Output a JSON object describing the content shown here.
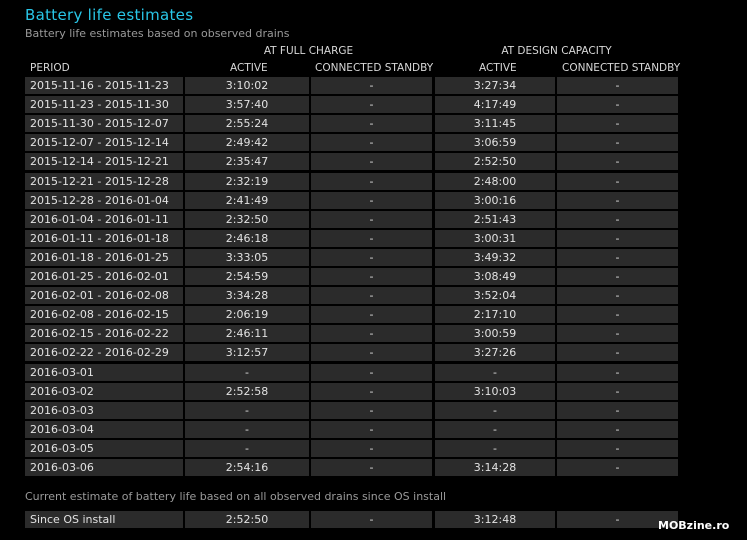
{
  "header": {
    "title": "Battery life estimates",
    "subtitle": "Battery life estimates based on observed drains"
  },
  "table": {
    "group_full": "AT FULL CHARGE",
    "group_design": "AT DESIGN CAPACITY",
    "col_period": "PERIOD",
    "col_full_active": "ACTIVE",
    "col_full_standby": "CONNECTED STANDBY",
    "col_design_active": "ACTIVE",
    "col_design_standby": "CONNECTED STANDBY",
    "rows": [
      {
        "period": "2015-11-16 - 2015-11-23",
        "full_active": "3:10:02",
        "full_standby": "-",
        "design_active": "3:27:34",
        "design_standby": "-"
      },
      {
        "period": "2015-11-23 - 2015-11-30",
        "full_active": "3:57:40",
        "full_standby": "-",
        "design_active": "4:17:49",
        "design_standby": "-"
      },
      {
        "period": "2015-11-30 - 2015-12-07",
        "full_active": "2:55:24",
        "full_standby": "-",
        "design_active": "3:11:45",
        "design_standby": "-"
      },
      {
        "period": "2015-12-07 - 2015-12-14",
        "full_active": "2:49:42",
        "full_standby": "-",
        "design_active": "3:06:59",
        "design_standby": "-"
      },
      {
        "period": "2015-12-14 - 2015-12-21",
        "full_active": "2:35:47",
        "full_standby": "-",
        "design_active": "2:52:50",
        "design_standby": "-"
      },
      {
        "period": "2015-12-21 - 2015-12-28",
        "full_active": "2:32:19",
        "full_standby": "-",
        "design_active": "2:48:00",
        "design_standby": "-"
      },
      {
        "period": "2015-12-28 - 2016-01-04",
        "full_active": "2:41:49",
        "full_standby": "-",
        "design_active": "3:00:16",
        "design_standby": "-"
      },
      {
        "period": "2016-01-04 - 2016-01-11",
        "full_active": "2:32:50",
        "full_standby": "-",
        "design_active": "2:51:43",
        "design_standby": "-"
      },
      {
        "period": "2016-01-11 - 2016-01-18",
        "full_active": "2:46:18",
        "full_standby": "-",
        "design_active": "3:00:31",
        "design_standby": "-"
      },
      {
        "period": "2016-01-18 - 2016-01-25",
        "full_active": "3:33:05",
        "full_standby": "-",
        "design_active": "3:49:32",
        "design_standby": "-"
      },
      {
        "period": "2016-01-25 - 2016-02-01",
        "full_active": "2:54:59",
        "full_standby": "-",
        "design_active": "3:08:49",
        "design_standby": "-"
      },
      {
        "period": "2016-02-01 - 2016-02-08",
        "full_active": "3:34:28",
        "full_standby": "-",
        "design_active": "3:52:04",
        "design_standby": "-"
      },
      {
        "period": "2016-02-08 - 2016-02-15",
        "full_active": "2:06:19",
        "full_standby": "-",
        "design_active": "2:17:10",
        "design_standby": "-"
      },
      {
        "period": "2016-02-15 - 2016-02-22",
        "full_active": "2:46:11",
        "full_standby": "-",
        "design_active": "3:00:59",
        "design_standby": "-"
      },
      {
        "period": "2016-02-22 - 2016-02-29",
        "full_active": "3:12:57",
        "full_standby": "-",
        "design_active": "3:27:26",
        "design_standby": "-"
      },
      {
        "period": "2016-03-01",
        "full_active": "-",
        "full_standby": "-",
        "design_active": "-",
        "design_standby": "-"
      },
      {
        "period": "2016-03-02",
        "full_active": "2:52:58",
        "full_standby": "-",
        "design_active": "3:10:03",
        "design_standby": "-"
      },
      {
        "period": "2016-03-03",
        "full_active": "-",
        "full_standby": "-",
        "design_active": "-",
        "design_standby": "-"
      },
      {
        "period": "2016-03-04",
        "full_active": "-",
        "full_standby": "-",
        "design_active": "-",
        "design_standby": "-"
      },
      {
        "period": "2016-03-05",
        "full_active": "-",
        "full_standby": "-",
        "design_active": "-",
        "design_standby": "-"
      },
      {
        "period": "2016-03-06",
        "full_active": "2:54:16",
        "full_standby": "-",
        "design_active": "3:14:28",
        "design_standby": "-"
      }
    ]
  },
  "summary": {
    "note": "Current estimate of battery life based on all observed drains since OS install",
    "period": "Since OS install",
    "full_active": "2:52:50",
    "full_standby": "-",
    "design_active": "3:12:48",
    "design_standby": "-"
  },
  "watermark": "MOBzine.ro",
  "colors": {
    "title": "#29c7e8",
    "background": "#000000",
    "cell": "#2b2b2b"
  }
}
